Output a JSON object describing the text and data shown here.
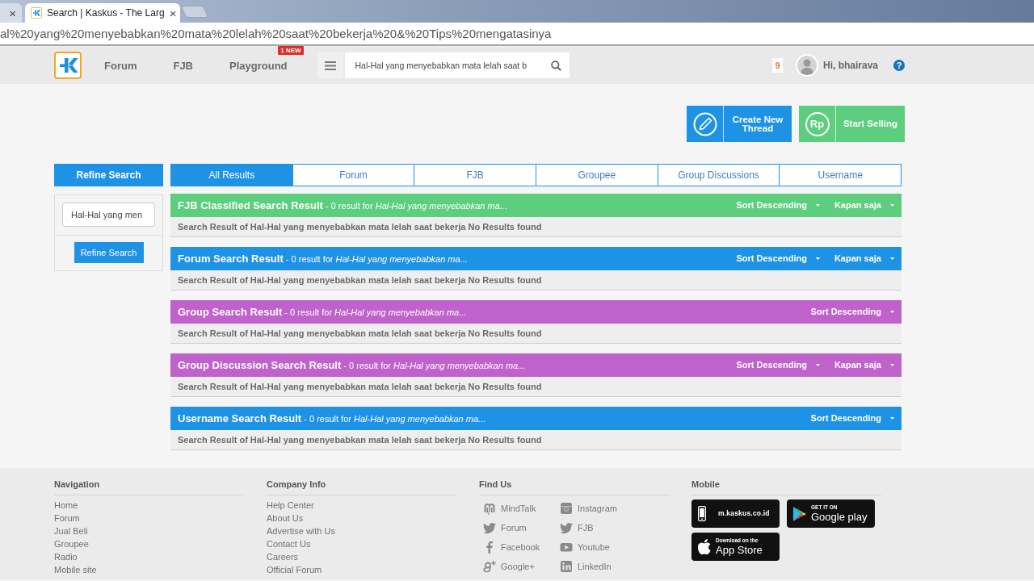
{
  "browser": {
    "tabs": [
      {
        "selected": false,
        "close": "×"
      },
      {
        "selected": true,
        "title": "Search | Kaskus - The Larg",
        "close": "×"
      }
    ],
    "address": "al%20yang%20menyebabkan%20mata%20lelah%20saat%20bekerja%20&%20Tips%20mengatasinya"
  },
  "header": {
    "nav": [
      {
        "label": "Forum"
      },
      {
        "label": "FJB"
      },
      {
        "label": "Playground",
        "badge": "1 NEW"
      }
    ],
    "search": {
      "value": "Hal-Hal yang menyebabkan mata lelah saat b"
    },
    "notifications": "9",
    "greeting": "Hi, bhairava",
    "help": "?"
  },
  "actions": [
    {
      "kind": "thread",
      "label": "Create New Thread"
    },
    {
      "kind": "sell",
      "icon_text": "Rp",
      "label": "Start Selling"
    }
  ],
  "refine": {
    "title": "Refine Search",
    "input": {
      "value": "Hal-Hal yang men"
    },
    "button": "Refine Search"
  },
  "tabs": [
    {
      "label": "All Results",
      "selected": true
    },
    {
      "label": "Forum",
      "selected": false
    },
    {
      "label": "FJB",
      "selected": false
    },
    {
      "label": "Groupee",
      "selected": false
    },
    {
      "label": "Group Discussions",
      "selected": false
    },
    {
      "label": "Username",
      "selected": false
    }
  ],
  "sections": [
    {
      "color": "#5dcd7e",
      "heading": "**FJB Classified Search Result** - 0 result for *Hal-Hal yang menyebabkan ma...*",
      "dropdowns": [
        "Sort Descending",
        "Kapan saja"
      ],
      "message": "Search Result of Hal-Hal yang menyebabkan mata lelah saat bekerja No Results found"
    },
    {
      "color": "#1e93e6",
      "heading": "**Forum Search Result** - 0 result for *Hal-Hal yang menyebabkan ma...*",
      "dropdowns": [
        "Sort Descending",
        "Kapan saja"
      ],
      "message": "Search Result of Hal-Hal yang menyebabkan mata lelah saat bekerja No Results found"
    },
    {
      "color": "#c062cb",
      "heading": "**Group Search Result** - 0 result for *Hal-Hal yang menyebabkan ma...*",
      "dropdowns": [
        "Sort Descending"
      ],
      "message": "Search Result of Hal-Hal yang menyebabkan mata lelah saat bekerja No Results found"
    },
    {
      "color": "#c062cb",
      "heading": "**Group Discussion Search Result** - 0 result for *Hal-Hal yang menyebabkan ma...*",
      "dropdowns": [
        "Sort Descending",
        "Kapan saja"
      ],
      "message": "Search Result of Hal-Hal yang menyebabkan mata lelah saat bekerja No Results found"
    },
    {
      "color": "#1e93e6",
      "heading": "**Username Search Result** - 0 result for *Hal-Hal yang menyebabkan ma...*",
      "dropdowns": [
        "Sort Descending"
      ],
      "message": "Search Result of Hal-Hal yang menyebabkan mata lelah saat bekerja No Results found"
    }
  ],
  "footer": {
    "navigation": {
      "title": "Navigation",
      "links": [
        "Home",
        "Forum",
        "Jual Beli",
        "Groupee",
        "Radio",
        "Mobile site"
      ]
    },
    "company": {
      "title": "Company Info",
      "links": [
        "Help Center",
        "About Us",
        "Advertise with Us",
        "Contact Us",
        "Careers",
        "Official Forum"
      ]
    },
    "find_us": {
      "title": "Find Us",
      "links": [
        {
          "kind": "mindtalk",
          "label": "MindTalk"
        },
        {
          "kind": "instagram",
          "label": "Instagram"
        },
        {
          "kind": "twitter",
          "label": "Forum"
        },
        {
          "kind": "twitter",
          "label": "FJB"
        },
        {
          "kind": "facebook",
          "label": "Facebook"
        },
        {
          "kind": "youtube",
          "label": "Youtube"
        },
        {
          "kind": "googleplus",
          "label": "Google+"
        },
        {
          "kind": "linkedin",
          "label": "LinkedIn"
        }
      ]
    },
    "mobile": {
      "title": "Mobile",
      "badges": [
        {
          "kind": "mobile-site",
          "lines": [
            "m.kaskus.co.id"
          ]
        },
        {
          "kind": "google-play",
          "lines": [
            "GET IT ON",
            "Google play"
          ]
        },
        {
          "kind": "app-store",
          "lines": [
            "Download on the",
            "App Store"
          ]
        }
      ]
    }
  }
}
